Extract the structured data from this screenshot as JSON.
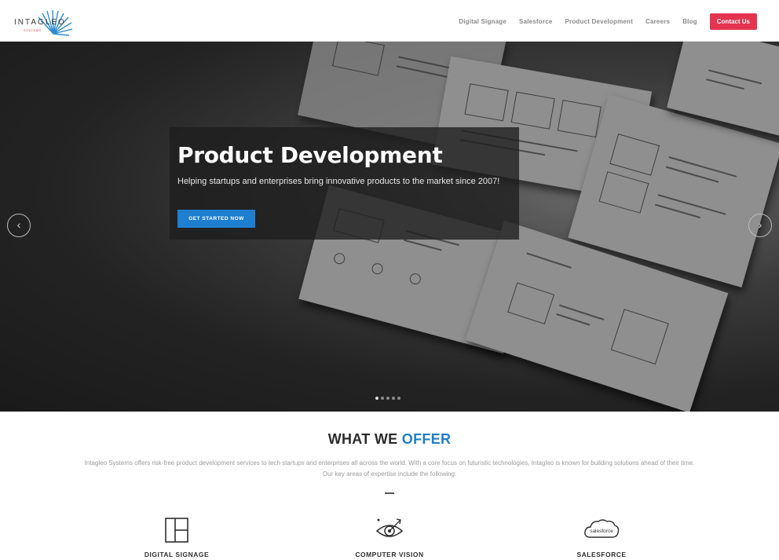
{
  "header": {
    "logo_text": "INTAGLEO",
    "logo_sub": "SYSTEMS",
    "nav": [
      "Digital Signage",
      "Salesforce",
      "Product Development",
      "Careers",
      "Blog"
    ],
    "contact_label": "Contact Us"
  },
  "hero": {
    "title": "Product Development",
    "subtitle": "Helping startups and enterprises bring innovative products to the market since 2007!",
    "button": "GET STARTED NOW",
    "prev_icon": "chevron-left-icon",
    "next_icon": "chevron-right-icon",
    "slides": 5,
    "active_slide": 1
  },
  "offer": {
    "title_main": "WHAT WE ",
    "title_accent": "OFFER",
    "text_1": "Intagleo Systems offers risk-free product development services to tech startups and enterprises all across the world. With a core focus on futuristic technologies, Intagleo is known for building solutions ahead of their time.",
    "text_2": "Our key areas of expertise include the following:",
    "services": [
      {
        "label": "DIGITAL SIGNAGE",
        "icon": "window-grid-icon"
      },
      {
        "label": "COMPUTER VISION",
        "icon": "eye-target-icon"
      },
      {
        "label": "SALESFORCE",
        "icon": "salesforce-cloud-icon"
      }
    ],
    "salesforce_logo_text": "salesforce"
  },
  "colors": {
    "accent_blue": "#1e7fc4",
    "contact_red": "#e4344f",
    "hero_button": "#1e7fd0"
  }
}
